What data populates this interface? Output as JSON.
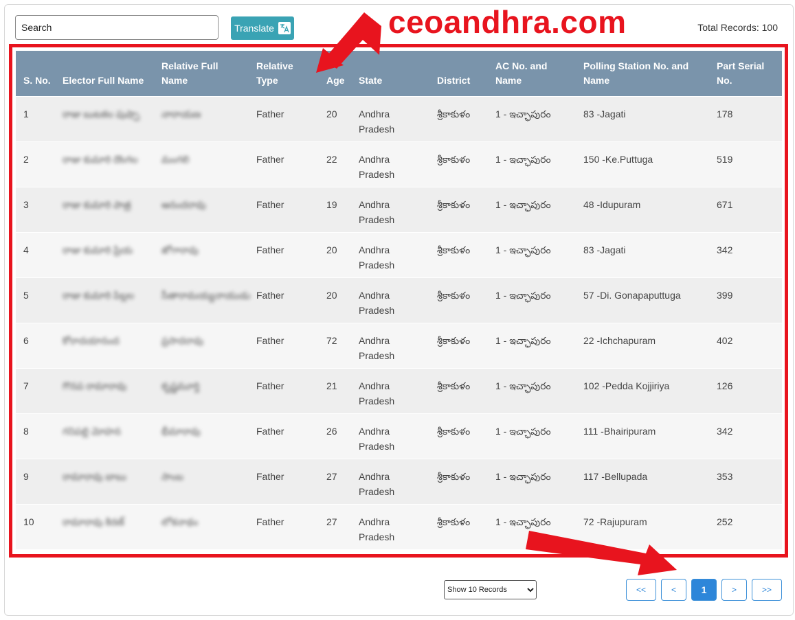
{
  "search": {
    "placeholder": "Search"
  },
  "translate": {
    "label": "Translate"
  },
  "brand": "ceoandhra.com",
  "total_records": "Total Records: 100",
  "table": {
    "headers": [
      "S. No.",
      "Elector Full Name",
      "Relative Full Name",
      "Relative Type",
      "Age",
      "State",
      "District",
      "AC No. and Name",
      "Polling Station No. and Name",
      "Part Serial No."
    ],
    "rows": [
      {
        "sno": "1",
        "elector": "రాజు బుటకల పుష్పా",
        "relative": "నారాయణ",
        "type": "Father",
        "age": "20",
        "state": "Andhra Pradesh",
        "district": "శ్రీకాకుళం",
        "ac": "1 - ఇచ్ఛాపురం",
        "ps": "83 -Jagati",
        "part": "178"
      },
      {
        "sno": "2",
        "elector": "రాజు కుమారి దొంగల",
        "relative": "మంగలి",
        "type": "Father",
        "age": "22",
        "state": "Andhra Pradesh",
        "district": "శ్రీకాకుళం",
        "ac": "1 - ఇచ్ఛాపురం",
        "ps": "150 -Ke.Puttuga",
        "part": "519"
      },
      {
        "sno": "3",
        "elector": "రాజు కుమారి పాత్ర",
        "relative": "ఆనందరావు",
        "type": "Father",
        "age": "19",
        "state": "Andhra Pradesh",
        "district": "శ్రీకాకుళం",
        "ac": "1 - ఇచ్ఛాపురం",
        "ps": "48 -Idupuram",
        "part": "671"
      },
      {
        "sno": "4",
        "elector": "రాజు కుమారి ప్రియ",
        "relative": "జోగారావు",
        "type": "Father",
        "age": "20",
        "state": "Andhra Pradesh",
        "district": "శ్రీకాకుళం",
        "ac": "1 - ఇచ్ఛాపురం",
        "ps": "83 -Jagati",
        "part": "342"
      },
      {
        "sno": "5",
        "elector": "రాజు కుమారి పిల్లల",
        "relative": "సీతారామయ్యనాయుడు",
        "type": "Father",
        "age": "20",
        "state": "Andhra Pradesh",
        "district": "శ్రీకాకుళం",
        "ac": "1 - ఇచ్ఛాపురం",
        "ps": "57 -Di. Gonapaputtuga",
        "part": "399"
      },
      {
        "sno": "6",
        "elector": "కోరాదయానంద",
        "relative": "ప్రసాదరావు",
        "type": "Father",
        "age": "72",
        "state": "Andhra Pradesh",
        "district": "శ్రీకాకుళం",
        "ac": "1 - ఇచ్ఛాపురం",
        "ps": "22 -Ichchapuram",
        "part": "402"
      },
      {
        "sno": "7",
        "elector": "గొనప రామారావు",
        "relative": "కృష్ణమూర్తి",
        "type": "Father",
        "age": "21",
        "state": "Andhra Pradesh",
        "district": "శ్రీకాకుళం",
        "ac": "1 - ఇచ్ఛాపురం",
        "ps": "102 -Pedda Kojjiriya",
        "part": "126"
      },
      {
        "sno": "8",
        "elector": "గనిపల్లి మోహన",
        "relative": "భీమారావు",
        "type": "Father",
        "age": "26",
        "state": "Andhra Pradesh",
        "district": "శ్రీకాకుళం",
        "ac": "1 - ఇచ్ఛాపురం",
        "ps": "111 -Bhairipuram",
        "part": "342"
      },
      {
        "sno": "9",
        "elector": "రామారావు బాబు",
        "relative": "సాంబ",
        "type": "Father",
        "age": "27",
        "state": "Andhra Pradesh",
        "district": "శ్రీకాకుళం",
        "ac": "1 - ఇచ్ఛాపురం",
        "ps": "117 -Bellupada",
        "part": "353"
      },
      {
        "sno": "10",
        "elector": "రామారావు కిరణ్",
        "relative": "లోకనాథం",
        "type": "Father",
        "age": "27",
        "state": "Andhra Pradesh",
        "district": "శ్రీకాకుళం",
        "ac": "1 - ఇచ్ఛాపురం",
        "ps": "72 -Rajupuram",
        "part": "252"
      }
    ]
  },
  "pager": {
    "select_label": "Show 10 Records",
    "first": "<<",
    "prev": "<",
    "current": "1",
    "next": ">",
    "last": ">>"
  },
  "colors": {
    "accent_red": "#e8141e",
    "header_bg": "#7a94ab",
    "button_teal": "#3aa3b4",
    "pager_blue": "#2d86d9"
  }
}
